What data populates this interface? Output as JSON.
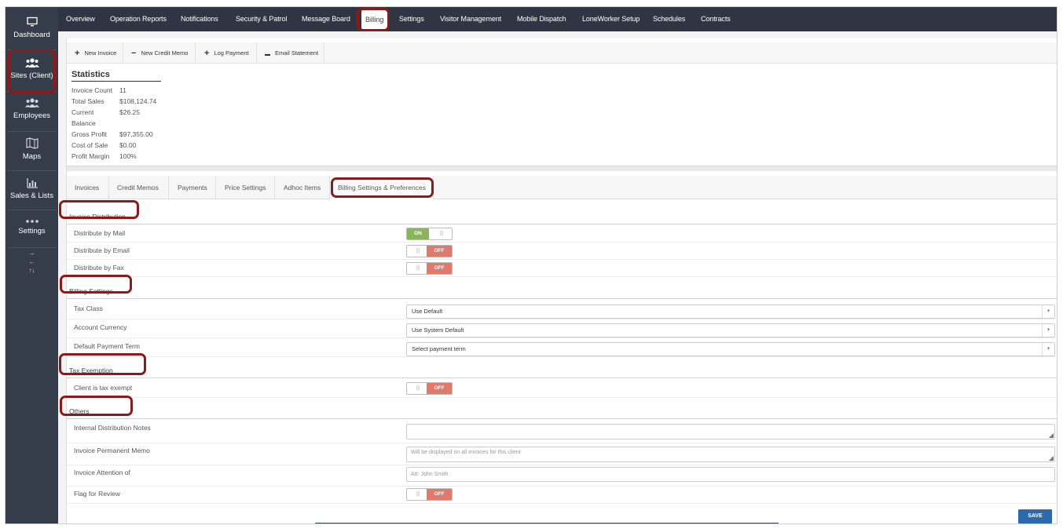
{
  "sidebar": {
    "items": [
      {
        "label": "Dashboard",
        "icon": "monitor-icon"
      },
      {
        "label": "Sites (Client)",
        "icon": "group-icon"
      },
      {
        "label": "Employees",
        "icon": "group-icon"
      },
      {
        "label": "Maps",
        "icon": "map-icon"
      },
      {
        "label": "Sales & Lists",
        "icon": "bar-chart-icon"
      },
      {
        "label": "Settings",
        "icon": "dots-icon"
      }
    ],
    "extra_glyphs": [
      "→",
      "←",
      "↑↓"
    ]
  },
  "topnav": {
    "tabs": [
      {
        "label": "Overview"
      },
      {
        "label": "Operation Reports"
      },
      {
        "label": "Notifications"
      },
      {
        "label": "Security & Patrol"
      },
      {
        "label": "Message Board"
      },
      {
        "label": "Billing"
      },
      {
        "label": "Settings"
      },
      {
        "label": "Visitor Management"
      },
      {
        "label": "Mobile Dispatch"
      },
      {
        "label": "LoneWorker Setup"
      },
      {
        "label": "Schedules"
      },
      {
        "label": "Contracts"
      }
    ],
    "active": "Billing"
  },
  "toolbar": {
    "buttons": [
      {
        "label": "New Invoice",
        "glyph": "+"
      },
      {
        "label": "New Credit Memo",
        "glyph": "−"
      },
      {
        "label": "Log Payment",
        "glyph": "+"
      },
      {
        "label": "Email Statement",
        "glyph": "▬"
      }
    ]
  },
  "statistics": {
    "title": "Statistics",
    "rows": [
      {
        "label": "Invoice Count",
        "value": "11"
      },
      {
        "label": "Total Sales",
        "value": "$108,124.74"
      },
      {
        "label": "Current",
        "value": "$26.25"
      },
      {
        "label": "Balance",
        "value": ""
      },
      {
        "label": "Gross Profit",
        "value": "$97,355.00"
      },
      {
        "label": "Cost of Sale",
        "value": "$0.00"
      },
      {
        "label": "Profit Margin",
        "value": "100%"
      }
    ]
  },
  "subtabs": {
    "tabs": [
      {
        "label": "Invoices"
      },
      {
        "label": "Credit Memos"
      },
      {
        "label": "Payments"
      },
      {
        "label": "Price Settings"
      },
      {
        "label": "Adhoc Items"
      },
      {
        "label": "Billing Settings & Preferences"
      }
    ],
    "active": "Billing Settings & Preferences"
  },
  "sections": {
    "invoice_distribution": {
      "title": "Invoice Distribution",
      "mail": {
        "label": "Distribute by Mail",
        "state": "ON"
      },
      "email": {
        "label": "Distribute by Email",
        "state": "OFF"
      },
      "fax": {
        "label": "Distribute by Fax",
        "state": "OFF"
      }
    },
    "billing_settings": {
      "title": "Billing Settings",
      "tax_class": {
        "label": "Tax Class",
        "value": "Use Default"
      },
      "currency": {
        "label": "Account Currency",
        "value": "Use System Default"
      },
      "payment_term": {
        "label": "Default Payment Term",
        "value": "Select payment term"
      }
    },
    "tax_exemption": {
      "title": "Tax Exemption",
      "exempt": {
        "label": "Client is tax exempt",
        "state": "OFF"
      }
    },
    "others": {
      "title": "Others",
      "notes": {
        "label": "Internal Distribution Notes",
        "value": ""
      },
      "memo": {
        "label": "Invoice Permanent Memo",
        "placeholder": "Will be displayed on all invoices for this client"
      },
      "attention": {
        "label": "Invoice Attention of",
        "placeholder": "Att: John Smith"
      },
      "review": {
        "label": "Flag for Review",
        "state": "OFF"
      }
    }
  },
  "toggle_labels": {
    "on": "ON",
    "off": "OFF",
    "grip": "|||"
  },
  "save_label": "SAVE",
  "colors": {
    "sidebar": "#353c4a",
    "topnav": "#2f3542",
    "toggle_on": "#8ab55a",
    "toggle_off": "#e07a6c",
    "save": "#2e6aab",
    "highlight": "#8b1a1a"
  }
}
